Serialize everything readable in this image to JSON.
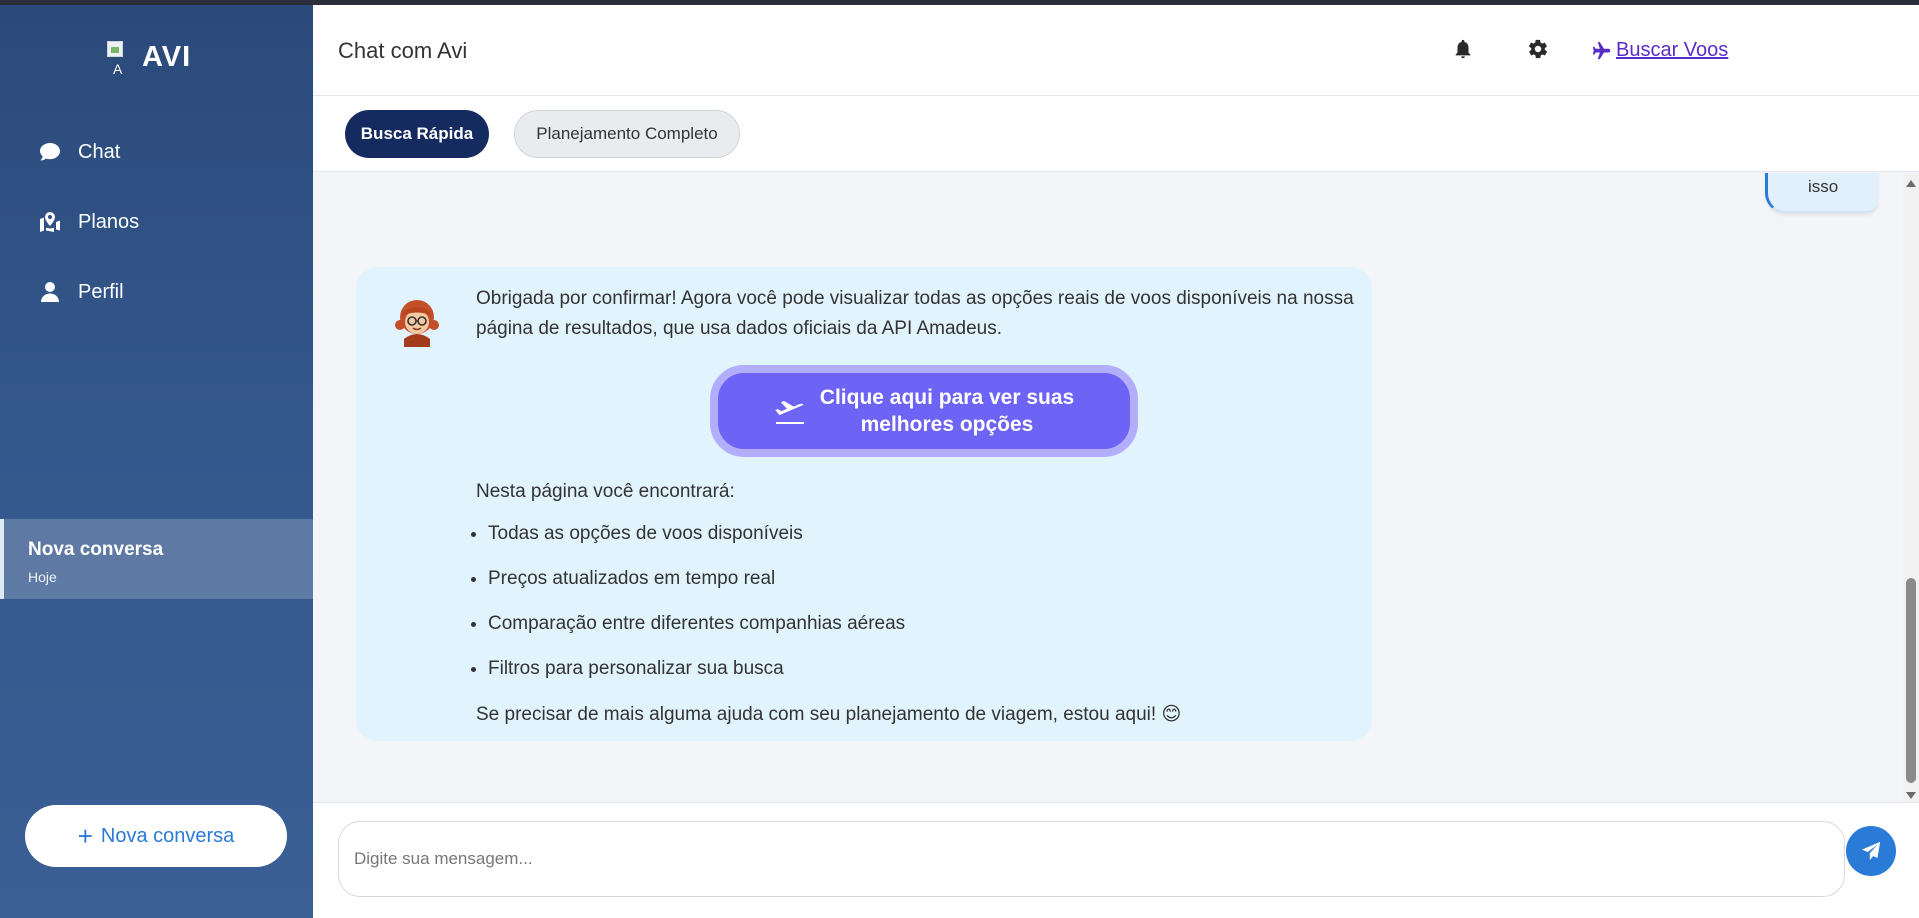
{
  "sidebar": {
    "logo_alt": "A",
    "logo_text": "AVI",
    "nav": [
      {
        "label": "Chat",
        "icon": "comment-icon"
      },
      {
        "label": "Planos",
        "icon": "map-icon"
      },
      {
        "label": "Perfil",
        "icon": "user-icon"
      }
    ],
    "conversation": {
      "title": "Nova conversa",
      "date": "Hoje"
    },
    "new_conversation_label": "Nova conversa"
  },
  "header": {
    "title": "Chat com Avi",
    "flight_link": "Buscar Voos"
  },
  "tabs": [
    {
      "label": "Busca Rápida",
      "active": true
    },
    {
      "label": "Planejamento Completo",
      "active": false
    }
  ],
  "messages": {
    "user_partial": "isso",
    "bot": {
      "intro": "Obrigada por confirmar! Agora você pode visualizar todas as opções reais de voos disponíveis na nossa página de resultados, que usa dados oficiais da API Amadeus.",
      "cta_line1": "Clique aqui para ver suas",
      "cta_line2": "melhores opções",
      "list_heading": "Nesta página você encontrará:",
      "features": [
        "Todas as opções de voos disponíveis",
        "Preços atualizados em tempo real",
        "Comparação entre diferentes companhias aéreas",
        "Filtros para personalizar sua busca"
      ],
      "closing": "Se precisar de mais alguma ajuda com seu planejamento de viagem, estou aqui! 😊"
    }
  },
  "composer": {
    "placeholder": "Digite sua mensagem..."
  },
  "colors": {
    "sidebar": "#2b4a7a",
    "accent_blue": "#2a7bd8",
    "tab_active": "#152a5e",
    "cta": "#6d63f5",
    "bot_bubble": "#e1f3fc",
    "link_purple": "#5a2cc7"
  }
}
